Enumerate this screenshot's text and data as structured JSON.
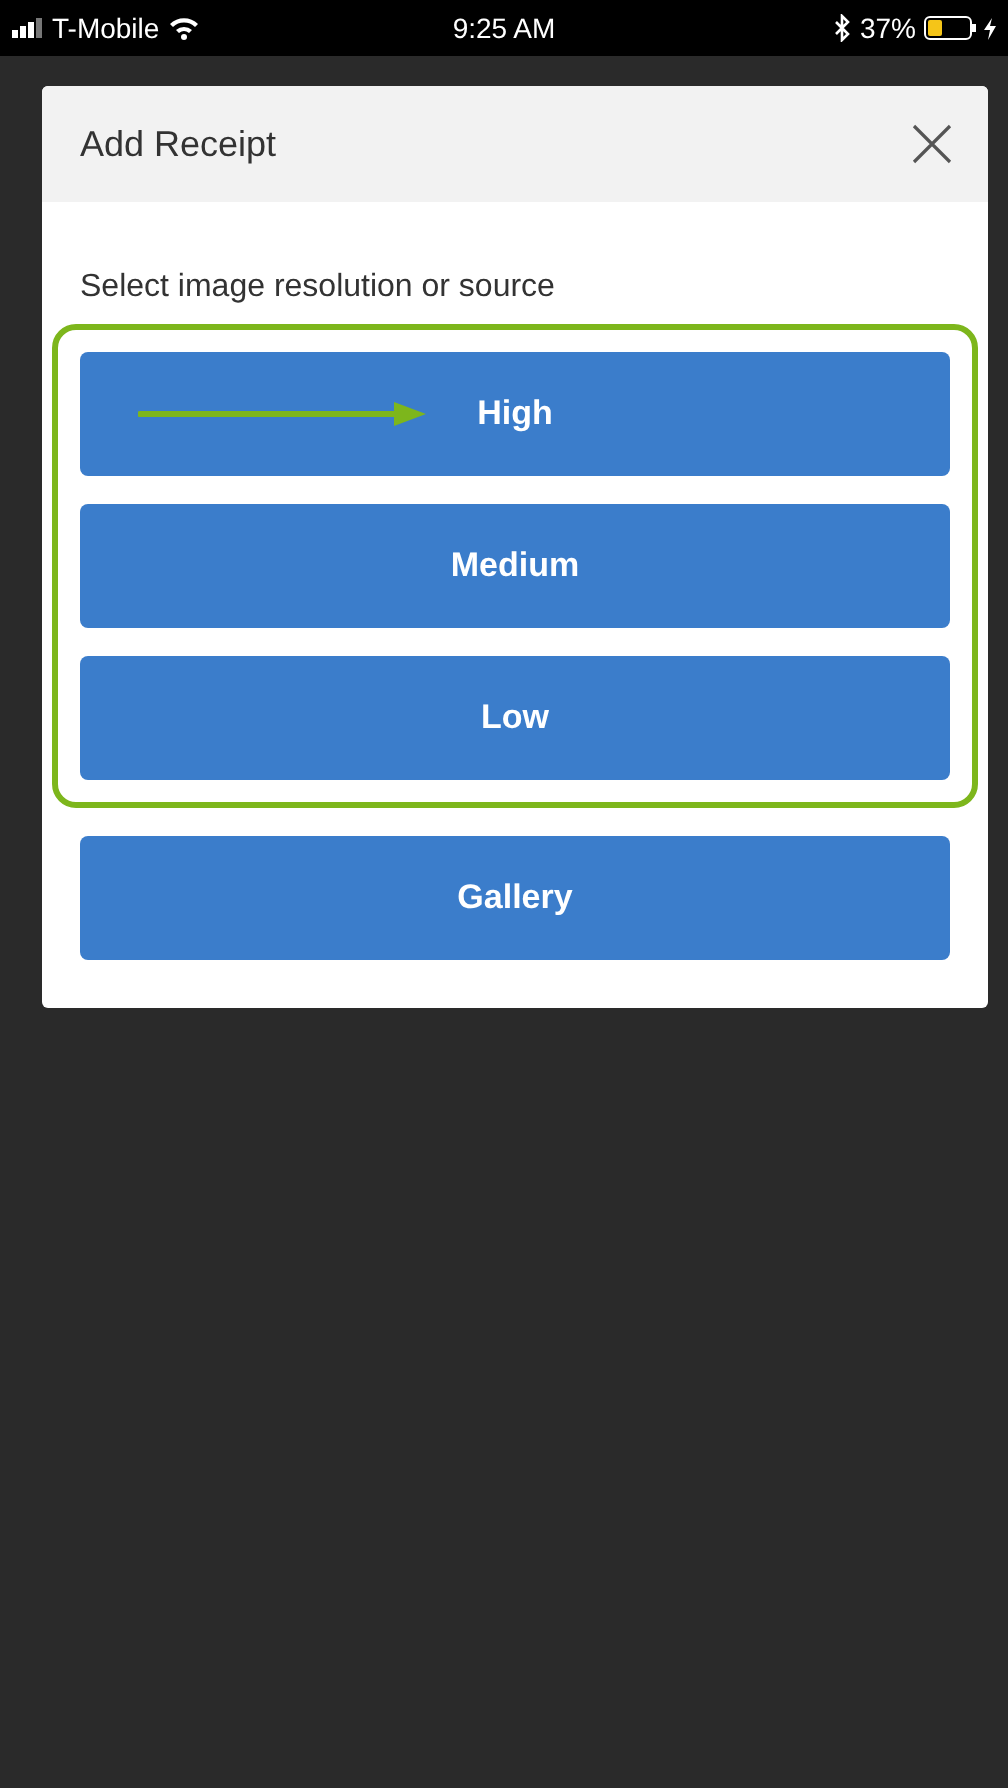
{
  "status_bar": {
    "carrier": "T-Mobile",
    "time": "9:25 AM",
    "battery_percent": "37%",
    "battery": {
      "level": 0.37,
      "charging": true
    }
  },
  "dialog": {
    "title": "Add Receipt",
    "prompt": "Select image resolution or source",
    "highlighted_options": [
      {
        "label": "High",
        "pointed": true
      },
      {
        "label": "Medium",
        "pointed": false
      },
      {
        "label": "Low",
        "pointed": false
      }
    ],
    "options": [
      {
        "label": "Gallery",
        "pointed": false
      }
    ]
  }
}
